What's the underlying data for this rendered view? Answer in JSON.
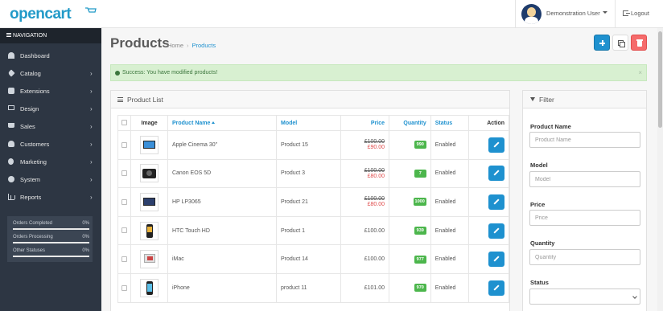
{
  "header": {
    "logo": "opencart",
    "user_name": "Demonstration User",
    "logout_label": "Logout"
  },
  "sidebar": {
    "heading": "NAVIGATION",
    "items": [
      {
        "label": "Dashboard",
        "icon": "dashboard-icon",
        "has_children": false
      },
      {
        "label": "Catalog",
        "icon": "tag-icon",
        "has_children": true
      },
      {
        "label": "Extensions",
        "icon": "puzzle-icon",
        "has_children": true
      },
      {
        "label": "Design",
        "icon": "monitor-icon",
        "has_children": true
      },
      {
        "label": "Sales",
        "icon": "cart-icon",
        "has_children": true
      },
      {
        "label": "Customers",
        "icon": "user-icon",
        "has_children": true
      },
      {
        "label": "Marketing",
        "icon": "share-icon",
        "has_children": true
      },
      {
        "label": "System",
        "icon": "cog-icon",
        "has_children": true
      },
      {
        "label": "Reports",
        "icon": "bar-chart-icon",
        "has_children": true
      }
    ],
    "stats": [
      {
        "label": "Orders Completed",
        "value": "0%"
      },
      {
        "label": "Orders Processing",
        "value": "0%"
      },
      {
        "label": "Other Statuses",
        "value": "0%"
      }
    ]
  },
  "page": {
    "title": "Products",
    "breadcrumb": [
      "Home",
      "Products"
    ],
    "alert": "Success: You have modified products!",
    "alert_close": "×"
  },
  "list": {
    "title": "Product List",
    "columns": {
      "image": "Image",
      "name": "Product Name",
      "model": "Model",
      "price": "Price",
      "quantity": "Quantity",
      "status": "Status",
      "action": "Action"
    },
    "rows": [
      {
        "image": "monitor",
        "name": "Apple Cinema 30\"",
        "model": "Product 15",
        "price_old": "£100.00",
        "price_new": "£90.00",
        "quantity": "990",
        "status": "Enabled"
      },
      {
        "image": "camera",
        "name": "Canon EOS 5D",
        "model": "Product 3",
        "price_old": "£100.00",
        "price_new": "£80.00",
        "quantity": "7",
        "status": "Enabled"
      },
      {
        "image": "laptop",
        "name": "HP LP3065",
        "model": "Product 21",
        "price_old": "£100.00",
        "price_new": "£80.00",
        "quantity": "1000",
        "status": "Enabled"
      },
      {
        "image": "htc",
        "name": "HTC Touch HD",
        "model": "Product 1",
        "price_old": "",
        "price_new": "£100.00",
        "quantity": "939",
        "status": "Enabled"
      },
      {
        "image": "imac",
        "name": "iMac",
        "model": "Product 14",
        "price_old": "",
        "price_new": "£100.00",
        "quantity": "977",
        "status": "Enabled"
      },
      {
        "image": "iphone",
        "name": "iPhone",
        "model": "product 11",
        "price_old": "",
        "price_new": "£101.00",
        "quantity": "970",
        "status": "Enabled"
      }
    ]
  },
  "filter": {
    "title": "Filter",
    "fields": [
      {
        "label": "Product Name",
        "placeholder": "Product Name"
      },
      {
        "label": "Model",
        "placeholder": "Model"
      },
      {
        "label": "Price",
        "placeholder": "Price"
      },
      {
        "label": "Quantity",
        "placeholder": "Quantity"
      }
    ],
    "status_label": "Status"
  },
  "colors": {
    "primary": "#1e91cf",
    "danger": "#f56b6b",
    "sidebar": "#2d3643",
    "success_bg": "#d8f0d1",
    "badge": "#4cb64c"
  }
}
